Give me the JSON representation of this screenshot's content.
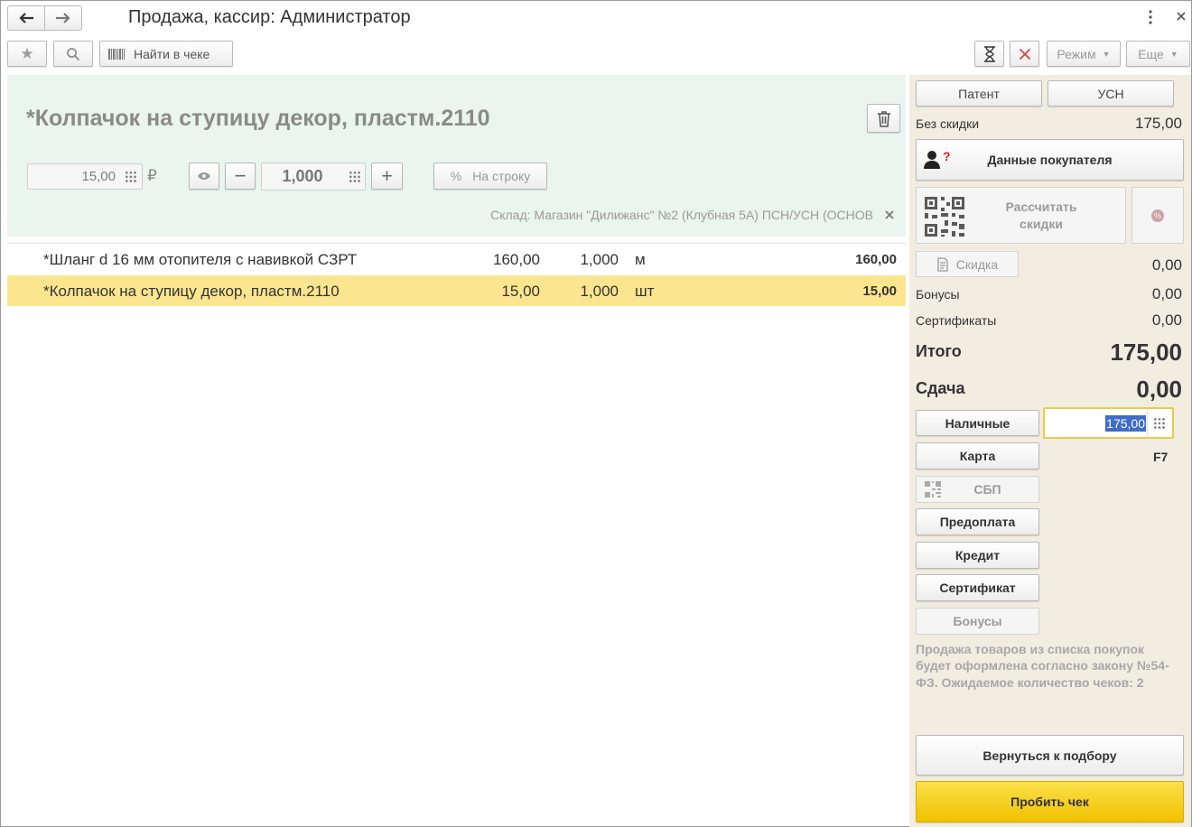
{
  "window": {
    "title": "Продажа, кассир: Администратор",
    "menu_icon": "more-vertical-icon",
    "close_icon": "close-icon"
  },
  "toolbar": {
    "find_in_receipt": "Найти в чеке",
    "mode_label": "Режим",
    "more_label": "Еще"
  },
  "product": {
    "title": "*Колпачок на ступицу декор, пластм.2110",
    "price": "15,00",
    "currency": "₽",
    "quantity": "1,000",
    "per_line_button": "На строку",
    "percent_sign": "%",
    "store": "Склад: Магазин \"Дилижанс\" №2 (Клубная 5А) ПСН/УСН (ОСНОВ"
  },
  "items": [
    {
      "name": "*Шланг d 16 мм отопителя с навивкой СЗРТ",
      "price": "160,00",
      "qty": "1,000",
      "unit": "м",
      "sum": "160,00"
    },
    {
      "name": "*Колпачок на ступицу декор, пластм.2110",
      "price": "15,00",
      "qty": "1,000",
      "unit": "шт",
      "sum": "15,00"
    }
  ],
  "side": {
    "tax_patent": "Патент",
    "tax_usn": "УСН",
    "no_discount_label": "Без скидки",
    "no_discount_value": "175,00",
    "buyer_data": "Данные покупателя",
    "calc_discounts": "Рассчитать скидки",
    "discount_button": "Скидка",
    "discount_value": "0,00",
    "bonuses_label": "Бонусы",
    "bonuses_value": "0,00",
    "certificates_label": "Сертификаты",
    "certificates_value": "0,00",
    "total_label": "Итого",
    "total_value": "175,00",
    "change_label": "Сдача",
    "change_value": "0,00",
    "pay_cash": "Наличные",
    "cash_amount": "175,00",
    "pay_card": "Карта",
    "card_hotkey": "F7",
    "pay_sbp": "СБП",
    "pay_prepayment": "Предоплата",
    "pay_credit": "Кредит",
    "pay_certificate": "Сертификат",
    "pay_bonuses": "Бонусы",
    "note": "Продажа товаров из списка покупок будет оформлена согласно закону №54-ФЗ. Ожидаемое количество чеков: 2",
    "return_to_selection": "Вернуться к подбору",
    "print_receipt": "Пробить чек"
  },
  "colors": {
    "product_panel": "#e9f5ee",
    "selected_row": "#fce58f",
    "side_panel": "#f2ede1",
    "print_button": "#f5c800",
    "input_focus": "#f0c94a"
  }
}
